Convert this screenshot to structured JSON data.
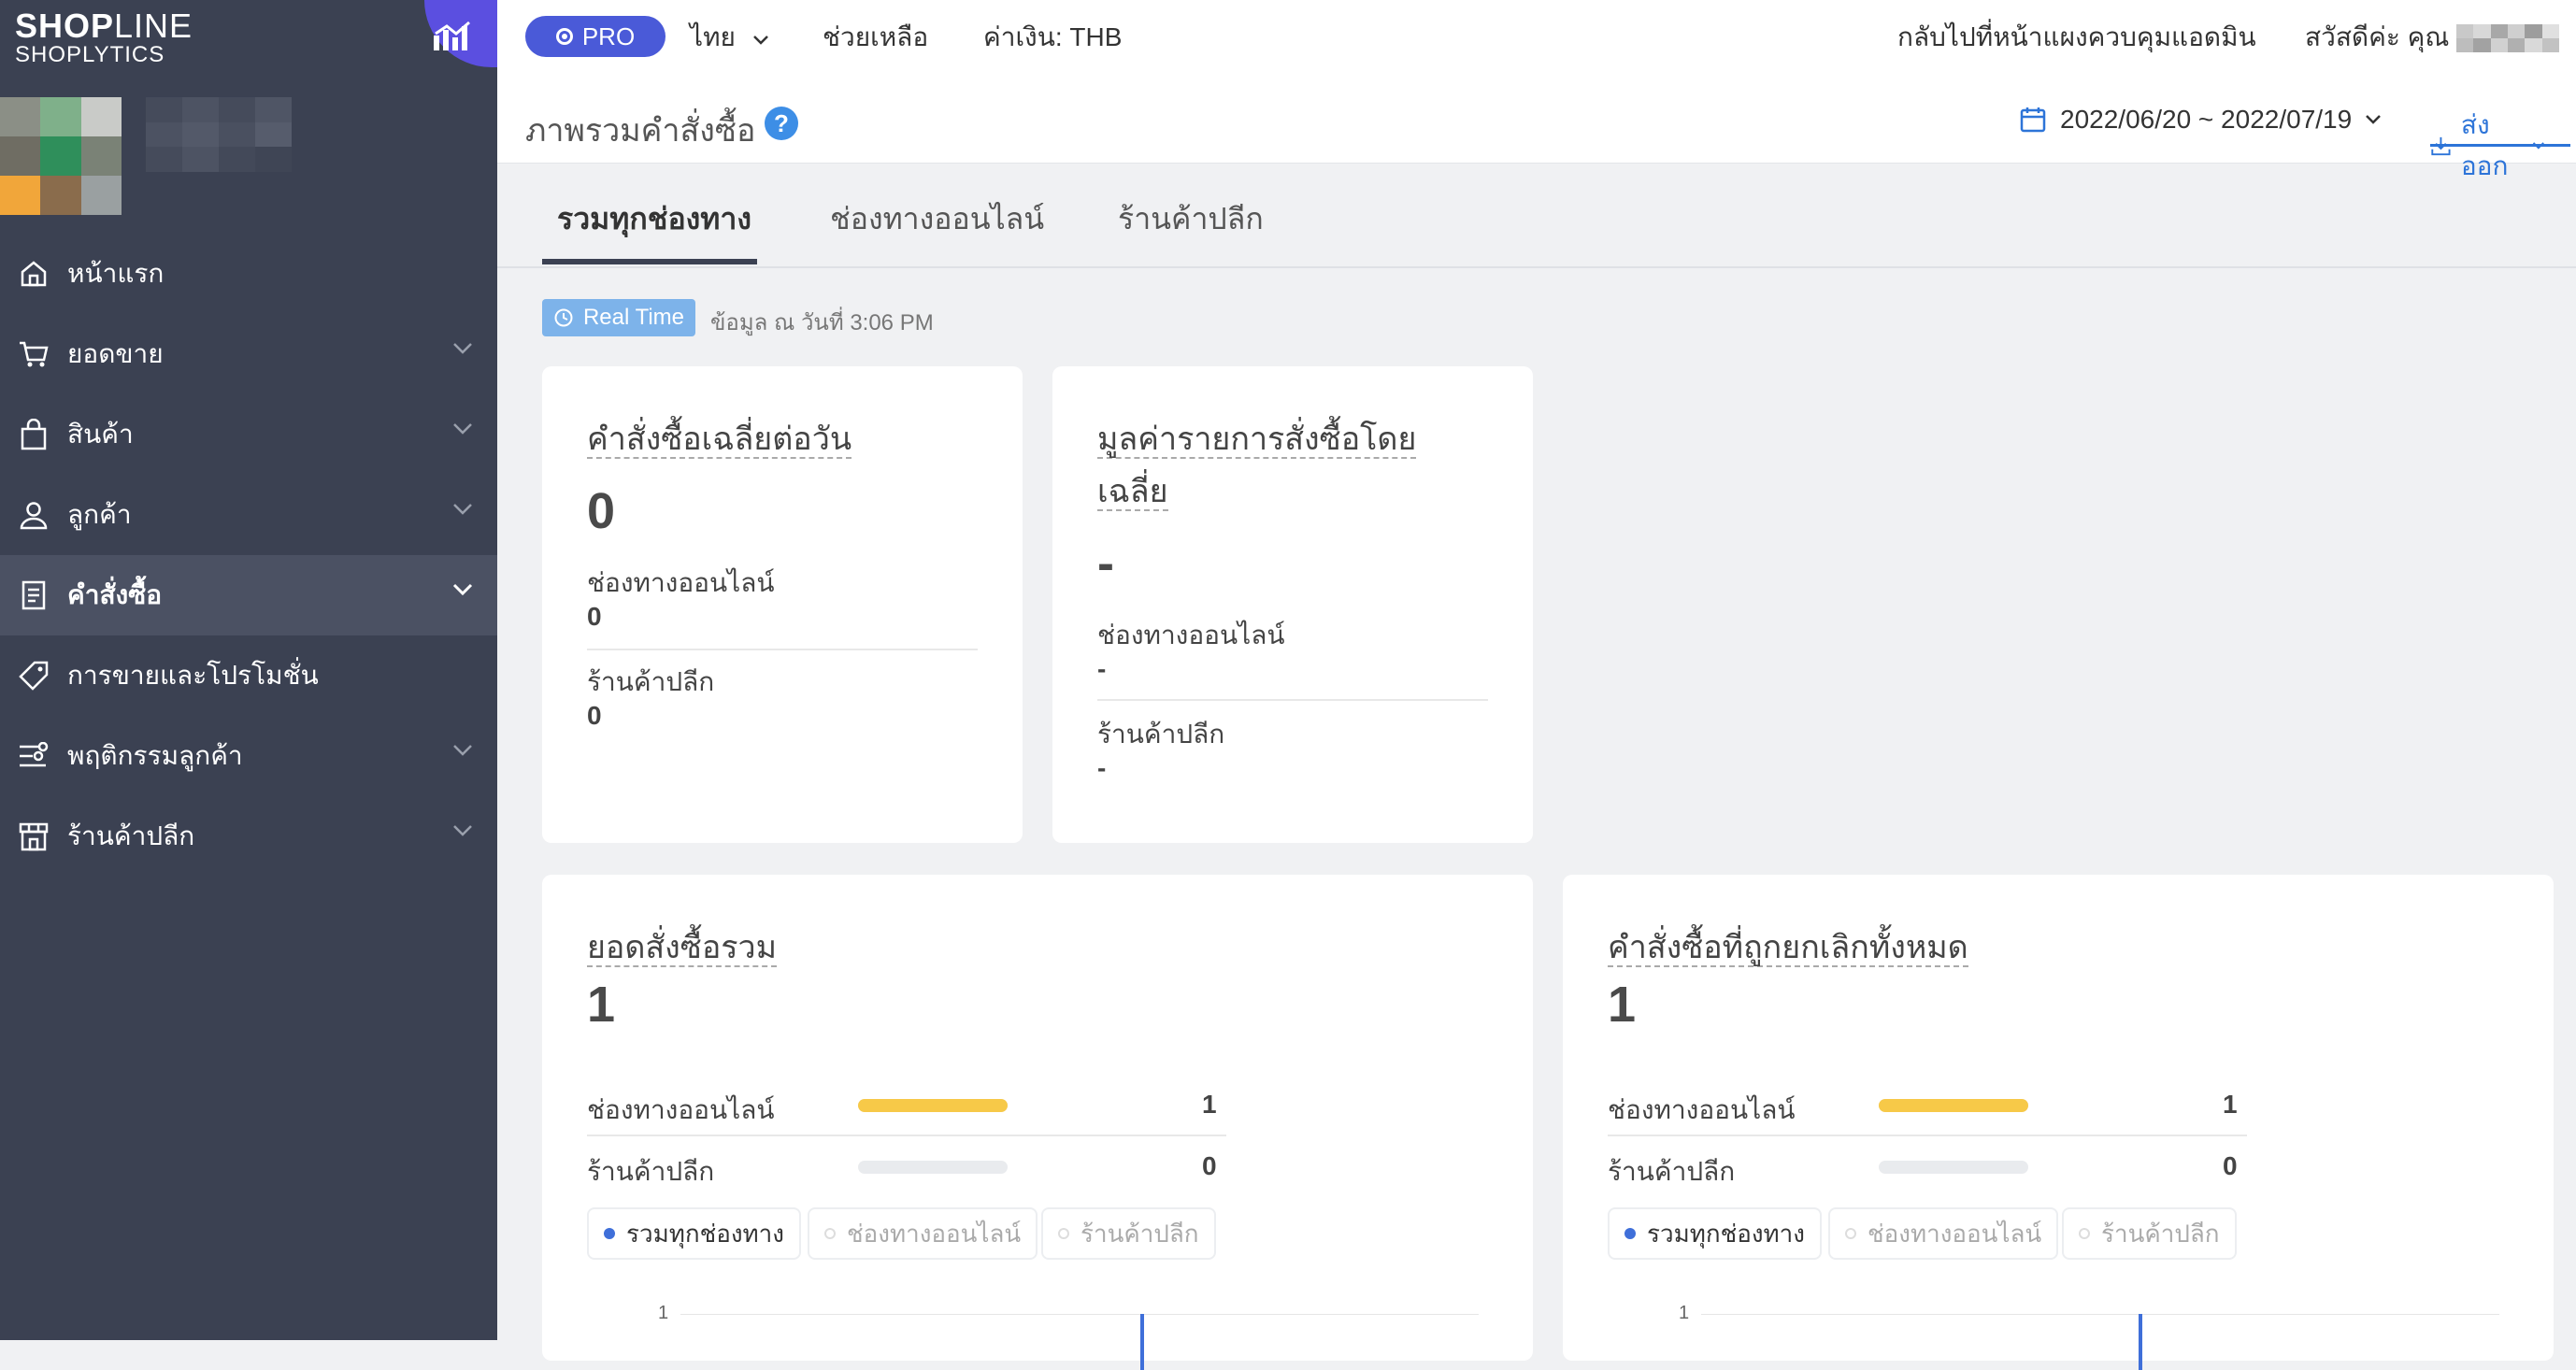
{
  "brand": {
    "logo_line1_bold": "SHOP",
    "logo_line1_thin": "LINE",
    "logo_line2": "SHOPLYTICS"
  },
  "sidebar": {
    "items": [
      {
        "label": "หน้าแรก",
        "icon": "home-icon"
      },
      {
        "label": "ยอดขาย",
        "icon": "cart-icon"
      },
      {
        "label": "สินค้า",
        "icon": "bag-icon"
      },
      {
        "label": "ลูกค้า",
        "icon": "user-icon"
      },
      {
        "label": "คำสั่งซื้อ",
        "icon": "clipboard-icon",
        "active": true
      },
      {
        "label": "การขายและโปรโมชั่น",
        "icon": "tag-icon"
      },
      {
        "label": "พฤติกรรมลูกค้า",
        "icon": "behavior-icon"
      },
      {
        "label": "ร้านค้าปลีก",
        "icon": "store-icon"
      }
    ]
  },
  "topbar": {
    "pro": "PRO",
    "language": "ไทย",
    "help": "ช่วยเหลือ",
    "currency": "ค่าเงิน: THB",
    "back_admin": "กลับไปที่หน้าแผงควบคุมแอดมิน",
    "greeting": "สวัสดีค่ะ คุณ"
  },
  "header": {
    "title": "ภาพรวมคำสั่งซื้อ",
    "help_mark": "?",
    "date_range": "2022/06/20 ~ 2022/07/19",
    "export": "ส่งออก"
  },
  "tabs": [
    "รวมทุกช่องทาง",
    "ช่องทางออนไลน์",
    "ร้านค้าปลีก"
  ],
  "realtime": {
    "badge": "Real Time",
    "note": "ข้อมูล ณ วันที่ 3:06 PM"
  },
  "cards": {
    "avg_daily_orders": {
      "title": "คำสั่งซื้อเฉลี่ยต่อวัน",
      "value": "0",
      "online_label": "ช่องทางออนไลน์",
      "online_value": "0",
      "retail_label": "ร้านค้าปลีก",
      "retail_value": "0"
    },
    "avg_order_value": {
      "title_line1": "มูลค่ารายการสั่งซื้อโดย",
      "title_line2": "เฉลี่ย",
      "value": "-",
      "online_label": "ช่องทางออนไลน์",
      "online_value": "-",
      "retail_label": "ร้านค้าปลีก",
      "retail_value": "-"
    },
    "total_orders": {
      "title": "ยอดสั่งซื้อรวม",
      "value": "1",
      "online_label": "ช่องทางออนไลน์",
      "online_value": "1",
      "online_share": 1.0,
      "retail_label": "ร้านค้าปลีก",
      "retail_value": "0",
      "retail_share": 0.0,
      "legend": [
        "รวมทุกช่องทาง",
        "ช่องทางออนไลน์",
        "ร้านค้าปลีก"
      ],
      "axis_tick": "1"
    },
    "cancelled_orders": {
      "title": "คำสั่งซื้อที่ถูกยกเลิกทั้งหมด",
      "value": "1",
      "online_label": "ช่องทางออนไลน์",
      "online_value": "1",
      "online_share": 1.0,
      "retail_label": "ร้านค้าปลีก",
      "retail_value": "0",
      "retail_share": 0.0,
      "legend": [
        "รวมทุกช่องทาง",
        "ช่องทางออนไลน์",
        "ร้านค้าปลีก"
      ],
      "axis_tick": "1"
    }
  },
  "colors": {
    "sidebar": "#3b4152",
    "accent": "#2d74d8",
    "bar_online": "#f7c948",
    "bar_empty": "#e9ebee",
    "series": "#3f6fd9"
  }
}
